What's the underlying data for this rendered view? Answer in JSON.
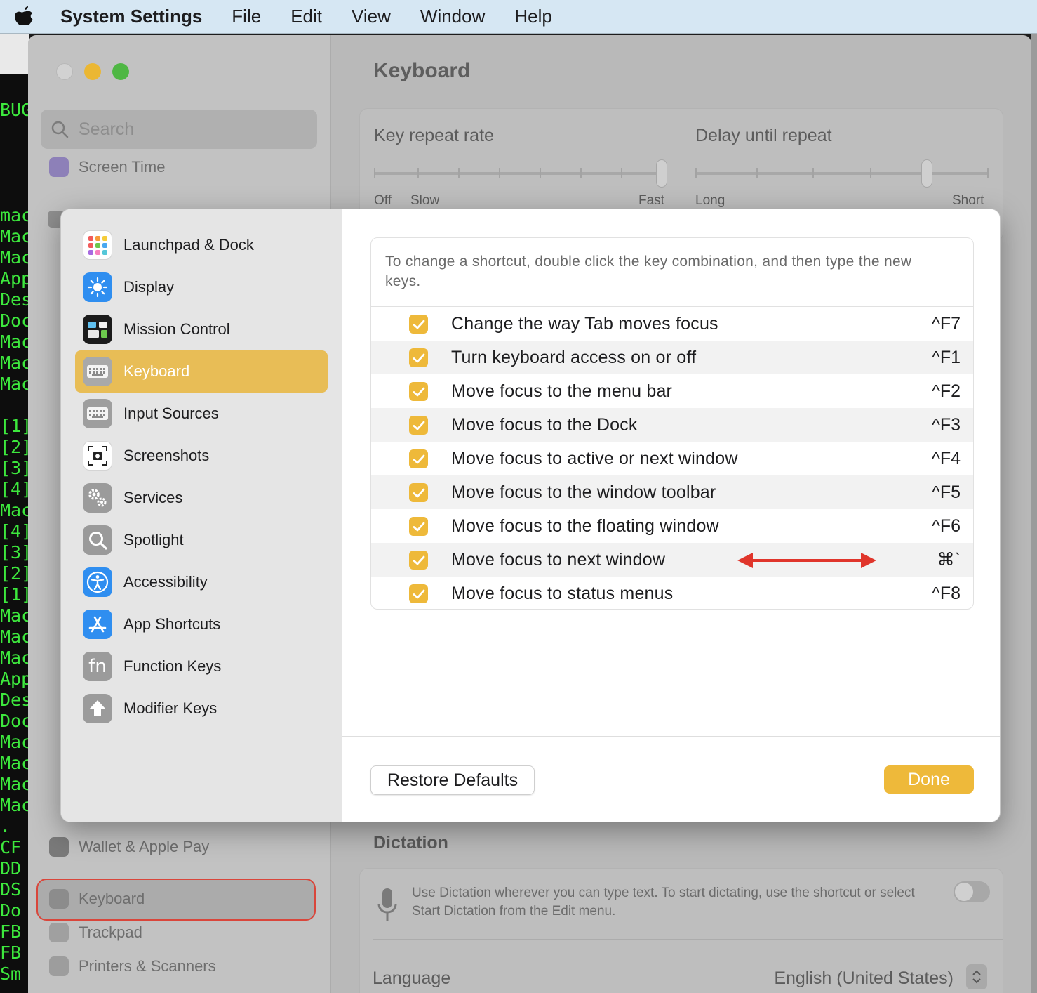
{
  "menubar": {
    "app_name": "System Settings",
    "items": [
      "File",
      "Edit",
      "View",
      "Window",
      "Help"
    ]
  },
  "terminal_lines": [
    "BUG",
    "mac",
    "Mac",
    "Mac",
    "App",
    "Des",
    "Doc",
    "Mac",
    "Mac",
    "Mac",
    "[1]",
    "[2]",
    "[3]",
    "[4]",
    "Mac",
    "[4]",
    "[3]",
    "[2]",
    "[1]",
    "Mac",
    "Mac",
    "Mac",
    "App",
    "Des",
    "Doc",
    "Mac",
    "Mac",
    "Mac",
    "Mac",
    ".",
    "CF",
    "DD",
    "DS",
    "Do",
    "FB",
    "FB",
    "Sm"
  ],
  "background_window": {
    "search_placeholder": "Search",
    "sidebar_items": {
      "screen_time": "Screen Time",
      "wallet": "Wallet & Apple Pay",
      "keyboard": "Keyboard",
      "trackpad": "Trackpad",
      "printers": "Printers & Scanners"
    },
    "title": "Keyboard",
    "key_repeat": {
      "label": "Key repeat rate",
      "left_labels": [
        "Off",
        "Slow"
      ],
      "right_label": "Fast"
    },
    "delay_repeat": {
      "label": "Delay until repeat",
      "left_label": "Long",
      "right_label": "Short"
    },
    "dictation": {
      "title": "Dictation",
      "description": "Use Dictation wherever you can type text. To start dictating, use the shortcut or select Start Dictation from the Edit menu.",
      "language_label": "Language",
      "language_value": "English (United States)"
    }
  },
  "sheet": {
    "sidebar": [
      {
        "label": "Launchpad & Dock",
        "icon": "launchpad-icon"
      },
      {
        "label": "Display",
        "icon": "display-icon"
      },
      {
        "label": "Mission Control",
        "icon": "mission-control-icon"
      },
      {
        "label": "Keyboard",
        "icon": "keyboard-icon",
        "selected": true
      },
      {
        "label": "Input Sources",
        "icon": "input-sources-icon"
      },
      {
        "label": "Screenshots",
        "icon": "screenshot-icon"
      },
      {
        "label": "Services",
        "icon": "services-gear-icon"
      },
      {
        "label": "Spotlight",
        "icon": "spotlight-icon"
      },
      {
        "label": "Accessibility",
        "icon": "accessibility-icon"
      },
      {
        "label": "App Shortcuts",
        "icon": "app-shortcuts-icon"
      },
      {
        "label": "Function Keys",
        "icon": "function-keys-icon"
      },
      {
        "label": "Modifier Keys",
        "icon": "modifier-keys-icon"
      }
    ],
    "instruction": "To change a shortcut, double click the key combination, and then type the new keys.",
    "shortcuts": [
      {
        "label": "Change the way Tab moves focus",
        "key": "^F7",
        "checked": true
      },
      {
        "label": "Turn keyboard access on or off",
        "key": "^F1",
        "checked": true
      },
      {
        "label": "Move focus to the menu bar",
        "key": "^F2",
        "checked": true
      },
      {
        "label": "Move focus to the Dock",
        "key": "^F3",
        "checked": true
      },
      {
        "label": "Move focus to active or next window",
        "key": "^F4",
        "checked": true
      },
      {
        "label": "Move focus to the window toolbar",
        "key": "^F5",
        "checked": true
      },
      {
        "label": "Move focus to the floating window",
        "key": "^F6",
        "checked": true
      },
      {
        "label": "Move focus to next window",
        "key": "⌘`",
        "checked": true
      },
      {
        "label": "Move focus to status menus",
        "key": "^F8",
        "checked": true
      }
    ],
    "buttons": {
      "restore": "Restore Defaults",
      "done": "Done"
    }
  },
  "colors": {
    "accent": "#eeb93a",
    "selected_sidebar": "#e8bd56",
    "annotation_arrow": "#e0352b",
    "terminal_text": "#3de83d"
  }
}
